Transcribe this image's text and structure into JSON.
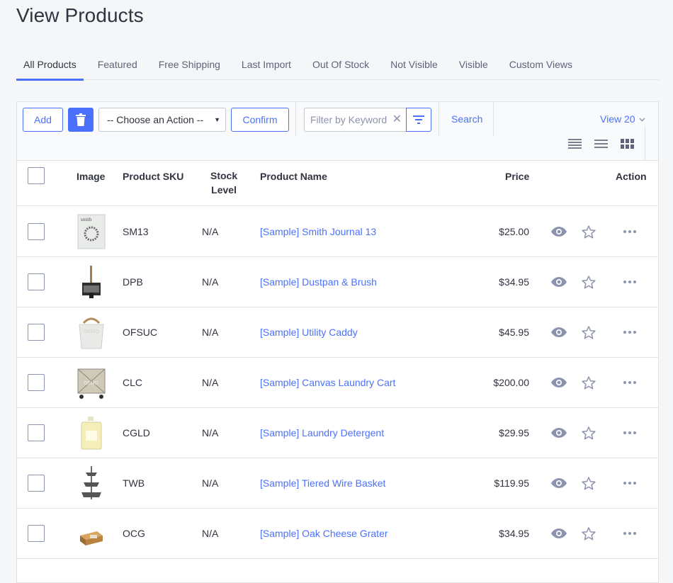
{
  "page": {
    "title": "View Products"
  },
  "tabs": [
    {
      "label": "All Products",
      "active": true
    },
    {
      "label": "Featured"
    },
    {
      "label": "Free Shipping"
    },
    {
      "label": "Last Import"
    },
    {
      "label": "Out Of Stock"
    },
    {
      "label": "Not Visible"
    },
    {
      "label": "Visible"
    },
    {
      "label": "Custom Views"
    }
  ],
  "toolbar": {
    "add_label": "Add",
    "action_select": "-- Choose an Action --",
    "confirm_label": "Confirm",
    "filter_placeholder": "Filter by Keyword",
    "search_label": "Search",
    "view_label": "View 20"
  },
  "table": {
    "headers": {
      "image": "Image",
      "sku": "Product SKU",
      "stock_line1": "Stock",
      "stock_line2": "Level",
      "name": "Product Name",
      "price": "Price",
      "action": "Action"
    },
    "rows": [
      {
        "sku": "SM13",
        "stock": "N/A",
        "name": "[Sample] Smith Journal 13",
        "price": "$25.00",
        "thumb": "journal"
      },
      {
        "sku": "DPB",
        "stock": "N/A",
        "name": "[Sample] Dustpan & Brush",
        "price": "$34.95",
        "thumb": "dustpan"
      },
      {
        "sku": "OFSUC",
        "stock": "N/A",
        "name": "[Sample] Utility Caddy",
        "price": "$45.95",
        "thumb": "caddy"
      },
      {
        "sku": "CLC",
        "stock": "N/A",
        "name": "[Sample] Canvas Laundry Cart",
        "price": "$200.00",
        "thumb": "cart"
      },
      {
        "sku": "CGLD",
        "stock": "N/A",
        "name": "[Sample] Laundry Detergent",
        "price": "$29.95",
        "thumb": "detergent"
      },
      {
        "sku": "TWB",
        "stock": "N/A",
        "name": "[Sample] Tiered Wire Basket",
        "price": "$119.95",
        "thumb": "basket"
      },
      {
        "sku": "OCG",
        "stock": "N/A",
        "name": "[Sample] Oak Cheese Grater",
        "price": "$34.95",
        "thumb": "grater"
      }
    ]
  },
  "colors": {
    "accent": "#4b71fc",
    "text": "#313440",
    "muted": "#8c93ad",
    "border": "#dfe3e8"
  }
}
